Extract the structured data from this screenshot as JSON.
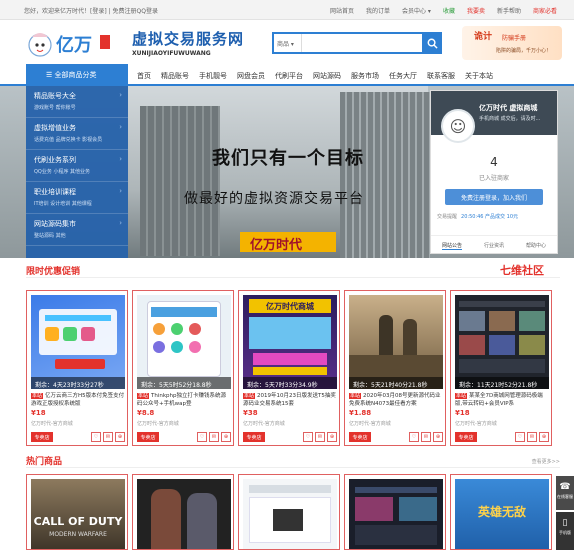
{
  "topbar": {
    "welcome": "您好，欢迎来亿万时代！[登录] | 免费注册QQ登录",
    "links": [
      "网站首页",
      "我的订单",
      "会员中心 ▾",
      "收藏",
      "我要卖",
      "新手帮助",
      "商家必看"
    ]
  },
  "header": {
    "logo_text": "亿万",
    "brand_cn": "虚拟交易服务网",
    "brand_en": "XUNIJIAOYIFUWUWANG",
    "search_category": "商品",
    "search_placeholder": "",
    "promo_title": "诡计",
    "promo_sub": "防骗手册",
    "promo_note": "陷阱的骗局，千万小心！"
  },
  "nav": {
    "all_categories": "全部商品分类",
    "items": [
      "首页",
      "精品账号",
      "手机靓号",
      "网盘会员",
      "代刷平台",
      "网站源码",
      "服务市场",
      "任务大厅",
      "联系客服",
      "关于本站"
    ]
  },
  "sidemenu": [
    {
      "title": "精品账号大全",
      "sub": "游戏账号  帮你账号"
    },
    {
      "title": "虚拟增值业务",
      "sub": "话费充值  品牌兑换卡  影视会员"
    },
    {
      "title": "代刷业务系列",
      "sub": "QQ业务  小程序  其他业务"
    },
    {
      "title": "职业培训课程",
      "sub": "IT培训  设计培训  其他课程"
    },
    {
      "title": "网站源码集市",
      "sub": "整站源码  其他"
    }
  ],
  "banner": {
    "slogan": "我们只有一个目标",
    "subslogan": "做最好的虚拟资源交易平台",
    "logo": "亿万时代"
  },
  "userpanel": {
    "name": "亿万时代 虚拟商城",
    "sub": "手机商城  成交后，请及时...",
    "count": "4",
    "count_label": "已入驻商家",
    "free_button": "免费注册登录，加入我们",
    "trade_label": "交易提醒",
    "trade_value": "20:50:46 产品成交 10元",
    "tabs": [
      "网站公告",
      "行业资讯",
      "帮助中心"
    ]
  },
  "sections": {
    "limited": "限时优惠促销",
    "hot": "热门商品",
    "more": "查看更多>>",
    "watermark": "七维社区"
  },
  "deals": [
    {
      "countdown": "剩余：4天23时33分27秒",
      "tag": "本站",
      "title": "亿万云商三方H5版本付免签支付游戏正版授权系统版",
      "price": "¥18",
      "seller": "亿万时代-官方商城",
      "shop": "专卖店"
    },
    {
      "countdown": "剩余：5天5时52分18.8秒",
      "tag": "本站",
      "title": "Thinkphp独立打卡赚钱系统源码公众号+手机wap登",
      "price": "¥8.8",
      "seller": "亿万时代-官方商城",
      "shop": "专卖店"
    },
    {
      "countdown": "剩余：5天7时33分34.9秒",
      "tag": "本站",
      "title": "2019年10月23日版发送T5抽奖源码业交易系统15套",
      "price": "¥38",
      "seller": "亿万时代-官方商城",
      "shop": "专卖店"
    },
    {
      "countdown": "剩余：5天21时40分21.8秒",
      "tag": "本站",
      "title": "2020年03月08号更新源代码业免费系统N4073最佳看方案",
      "price": "¥1.88",
      "seller": "亿万时代-官方商城",
      "shop": "专卖店"
    },
    {
      "countdown": "剩余：11天21时52分21.8秒",
      "tag": "本站",
      "title": "某某全7D商城网管理源码极端版,带云转码+会员VIP系",
      "price": "¥18",
      "seller": "亿万时代-官方商城",
      "shop": "专卖店"
    }
  ],
  "hot_items": [
    "CALL OF DUTY",
    "",
    "",
    "",
    "英雄无敌"
  ],
  "hot_item_sub": "MODERN WARFARE",
  "fab": {
    "contact": "在线客服",
    "phone": "手机版"
  }
}
